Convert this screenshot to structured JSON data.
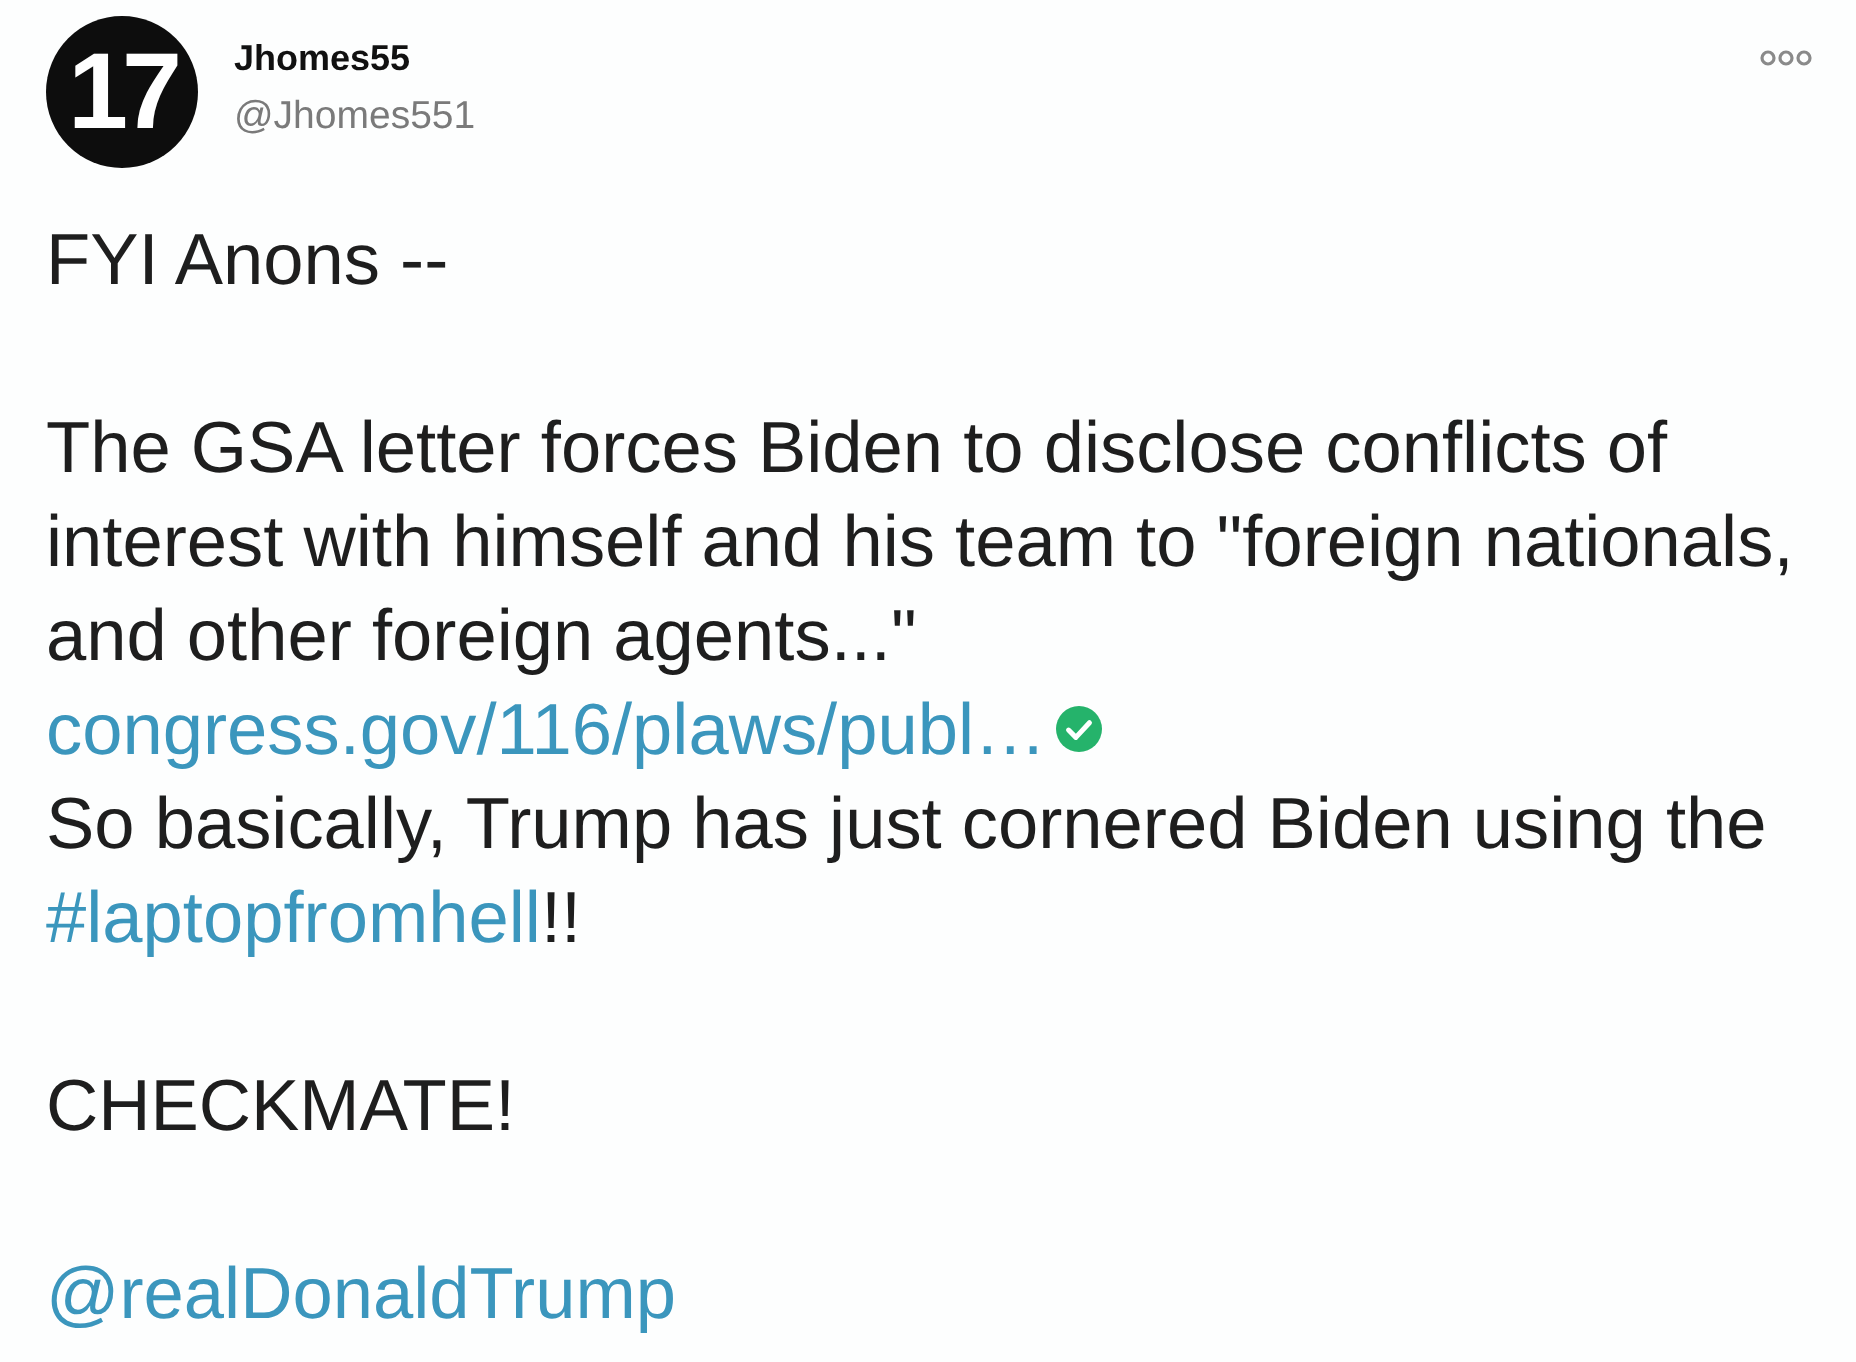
{
  "tweet": {
    "author": {
      "avatar_text": "17",
      "name": "Jhomes55",
      "handle": "@Jhomes551"
    },
    "paragraphs": [
      {
        "lines": [
          [
            {
              "kind": "text",
              "text": "FYI Anons --"
            }
          ]
        ]
      },
      {
        "lines": [
          [
            {
              "kind": "text",
              "text": "The GSA letter forces Biden to disclose conflicts of interest with himself and his team to \"foreign nationals, and other foreign agents...\""
            }
          ],
          [
            {
              "kind": "link",
              "text": "congress.gov/116/plaws/publ…",
              "verified": true
            }
          ],
          [
            {
              "kind": "text",
              "text": "So basically, Trump has just cornered Biden using the "
            },
            {
              "kind": "hashtag",
              "text": "#laptopfromhell"
            },
            {
              "kind": "text",
              "text": "!!"
            }
          ]
        ]
      },
      {
        "lines": [
          [
            {
              "kind": "text",
              "text": "CHECKMATE!"
            }
          ]
        ]
      },
      {
        "lines": [
          [
            {
              "kind": "mention",
              "text": "@realDonaldTrump"
            }
          ]
        ]
      }
    ]
  }
}
